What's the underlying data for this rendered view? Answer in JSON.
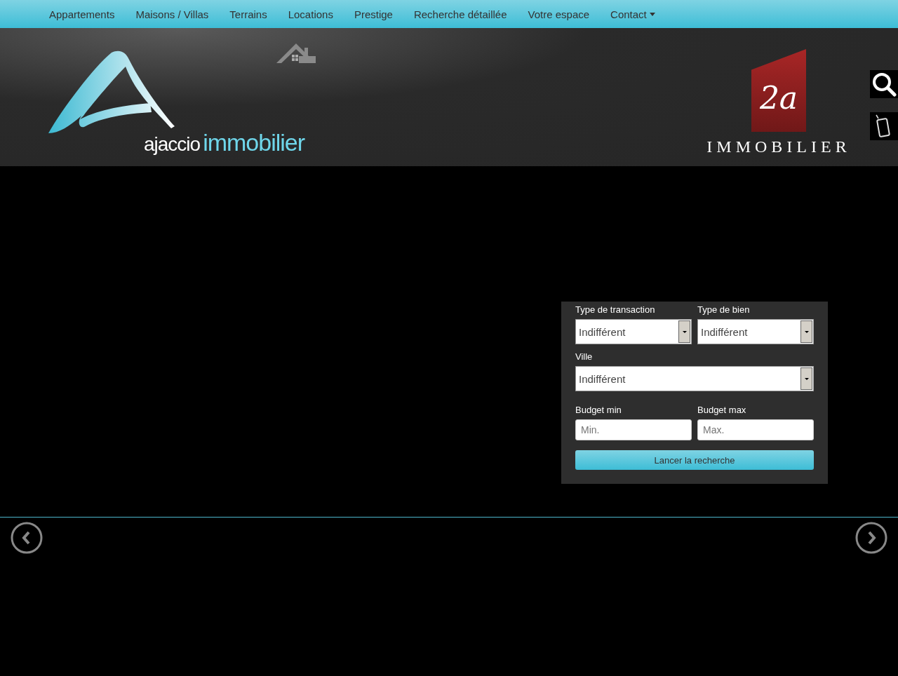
{
  "nav": [
    {
      "label": "Appartements",
      "dropdown": false
    },
    {
      "label": "Maisons / Villas",
      "dropdown": false
    },
    {
      "label": "Terrains",
      "dropdown": false
    },
    {
      "label": "Locations",
      "dropdown": false
    },
    {
      "label": "Prestige",
      "dropdown": false
    },
    {
      "label": "Recherche détaillée",
      "dropdown": false
    },
    {
      "label": "Votre espace",
      "dropdown": false
    },
    {
      "label": "Contact",
      "dropdown": true
    }
  ],
  "logo": {
    "word1": "ajaccio",
    "word2": "immobilier"
  },
  "partner_logo": {
    "mark": "2a",
    "name": "IMMOBILIER"
  },
  "search_form": {
    "transaction": {
      "label": "Type de transaction",
      "value": "Indifférent"
    },
    "property_type": {
      "label": "Type de bien",
      "value": "Indifférent"
    },
    "city": {
      "label": "Ville",
      "value": "Indifférent"
    },
    "budget_min": {
      "label": "Budget min",
      "placeholder": "Min."
    },
    "budget_max": {
      "label": "Budget max",
      "placeholder": "Max."
    },
    "submit": "Lancer la recherche"
  }
}
